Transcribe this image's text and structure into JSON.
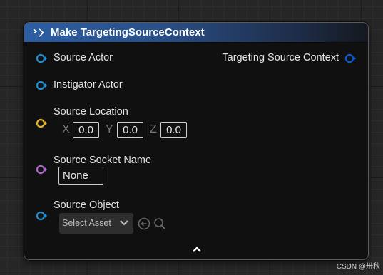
{
  "node": {
    "title": "Make TargetingSourceContext",
    "inputs": {
      "source_actor": "Source Actor",
      "instigator_actor": "Instigator Actor",
      "source_location": "Source Location",
      "source_socket_name": "Source Socket Name",
      "source_object": "Source Object"
    },
    "location": {
      "x_label": "X",
      "x_value": "0.0",
      "y_label": "Y",
      "y_value": "0.0",
      "z_label": "Z",
      "z_value": "0.0"
    },
    "socket_name_value": "None",
    "asset_select_label": "Select Asset",
    "output": "Targeting Source Context"
  },
  "icons": {
    "header": "struct-make-icon",
    "asset_dropdown": "chevron-down-icon",
    "use_selected": "arrow-left-circle-icon",
    "browse": "magnifier-icon",
    "expand": "chevron-up-icon"
  },
  "colors": {
    "object_pin": "#1f8fd6",
    "vector_pin": "#e3b427",
    "name_pin": "#b06acb",
    "struct_pin": "#0d5bd1",
    "header_blue": "#2d5ea3"
  },
  "watermark": "CSDN @卅秋"
}
